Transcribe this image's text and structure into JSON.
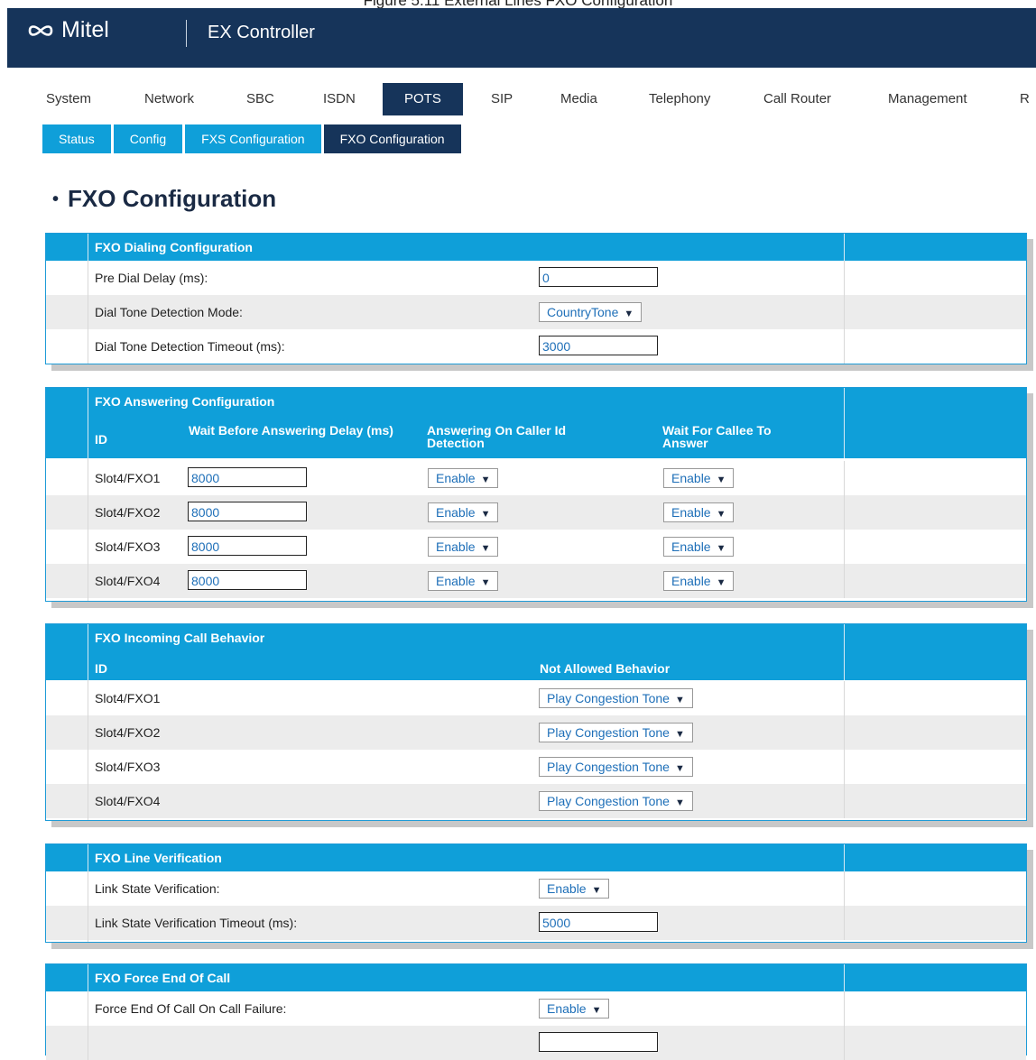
{
  "caption": "Figure 5.11 External Lines FXO Configuration",
  "header": {
    "brand": "Mitel",
    "product": "EX Controller"
  },
  "main_nav": [
    "System",
    "Network",
    "SBC",
    "ISDN",
    "POTS",
    "SIP",
    "Media",
    "Telephony",
    "Call Router",
    "Management",
    "R"
  ],
  "main_nav_active": "POTS",
  "sub_nav": [
    "Status",
    "Config",
    "FXS Configuration",
    "FXO Configuration"
  ],
  "sub_nav_active": "FXO Configuration",
  "page_title": "FXO Configuration",
  "dialing": {
    "title": "FXO Dialing Configuration",
    "pre_dial_label": "Pre Dial Delay (ms):",
    "pre_dial_value": "0",
    "dial_tone_mode_label": "Dial Tone Detection Mode:",
    "dial_tone_mode_value": "CountryTone",
    "dial_tone_timeout_label": "Dial Tone Detection Timeout (ms):",
    "dial_tone_timeout_value": "3000"
  },
  "answering": {
    "title": "FXO Answering Configuration",
    "col_id": "ID",
    "col_wait": "Wait Before Answering Delay (ms)",
    "col_caller_id": "Answering On Caller Id Detection",
    "col_callee": "Wait For Callee To Answer",
    "rows": [
      {
        "id": "Slot4/FXO1",
        "delay": "8000",
        "caller_id": "Enable",
        "callee": "Enable"
      },
      {
        "id": "Slot4/FXO2",
        "delay": "8000",
        "caller_id": "Enable",
        "callee": "Enable"
      },
      {
        "id": "Slot4/FXO3",
        "delay": "8000",
        "caller_id": "Enable",
        "callee": "Enable"
      },
      {
        "id": "Slot4/FXO4",
        "delay": "8000",
        "caller_id": "Enable",
        "callee": "Enable"
      }
    ]
  },
  "incoming": {
    "title": "FXO Incoming Call Behavior",
    "col_id": "ID",
    "col_behavior": "Not Allowed Behavior",
    "rows": [
      {
        "id": "Slot4/FXO1",
        "behavior": "Play Congestion Tone"
      },
      {
        "id": "Slot4/FXO2",
        "behavior": "Play Congestion Tone"
      },
      {
        "id": "Slot4/FXO3",
        "behavior": "Play Congestion Tone"
      },
      {
        "id": "Slot4/FXO4",
        "behavior": "Play Congestion Tone"
      }
    ]
  },
  "line_verification": {
    "title": "FXO Line Verification",
    "link_state_label": "Link State Verification:",
    "link_state_value": "Enable",
    "timeout_label": "Link State Verification Timeout (ms):",
    "timeout_value": "5000"
  },
  "force_end": {
    "title": "FXO Force End Of Call",
    "failure_label": "Force End Of Call On Call Failure:",
    "failure_value": "Enable"
  },
  "colors": {
    "header_dark": "#16345a",
    "accent_blue": "#0f9fd9",
    "value_blue": "#1e6fb8"
  }
}
